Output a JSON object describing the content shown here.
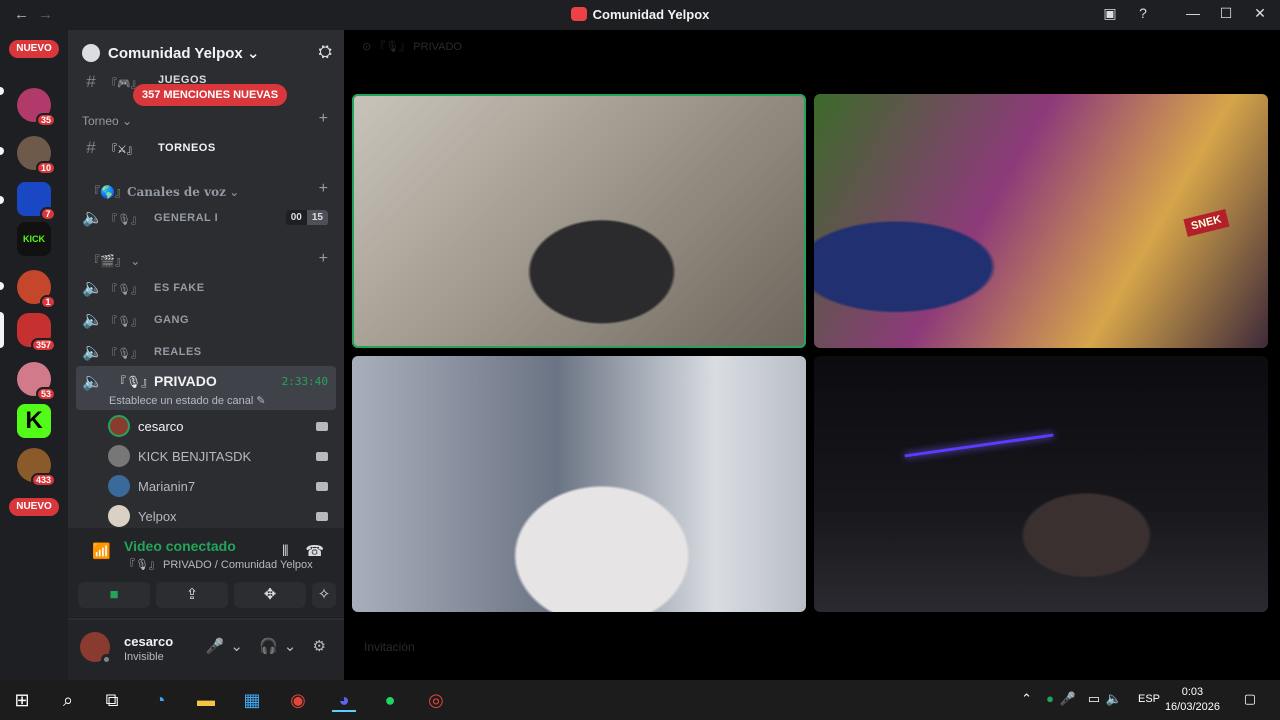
{
  "window": {
    "title": "Comunidad Yelpox",
    "back_icon": "←",
    "forward_icon": "→"
  },
  "rail": {
    "new_top": "NUEVO",
    "new_bottom": "NUEVO",
    "servers": [
      {
        "badge": "35",
        "color": "#b23a6a"
      },
      {
        "badge": "10",
        "color": "#6e5a4a"
      },
      {
        "badge": "7",
        "color": "#1a48c4"
      },
      {
        "badge": "",
        "label": "KICK",
        "color": "#111111"
      },
      {
        "badge": "1",
        "color": "#c5472b"
      },
      {
        "badge": "357",
        "color": "#c73030"
      },
      {
        "badge": "53",
        "color": "#d07a8a"
      },
      {
        "badge": "",
        "label": "K",
        "color": "#53fc18"
      },
      {
        "badge": "433",
        "color": "#8a5a2a"
      }
    ]
  },
  "sidebar": {
    "guild_name": "Comunidad Yelpox",
    "mention_pill": "357 MENCIONES NUEVAS",
    "channel_juegos": "JUEGOS",
    "category_torneo": "Torneo",
    "channel_torneos": "TORNEOS",
    "category_voz": "Canales de voz",
    "channel_general": "GENERAL I",
    "general_count_a": "00",
    "general_count_b": "15",
    "channel_fake": "ES FAKE",
    "channel_gang": "GANG",
    "channel_reales": "REALES",
    "channel_privado": "PRIVADO",
    "privado_timer": "2:33:40",
    "privado_status": "Establece un estado de canal",
    "members": [
      {
        "name": "cesarco",
        "color": "#8a3b2f"
      },
      {
        "name": "KICK BENJITASDK",
        "color": "#777777"
      },
      {
        "name": "Marianin7",
        "color": "#3a6a9a"
      },
      {
        "name": "Yelpox",
        "color": "#cfa"
      }
    ]
  },
  "voice": {
    "title": "Video conectado",
    "subtitle": "PRIVADO / Comunidad Yelpox"
  },
  "user": {
    "name": "cesarco",
    "status": "Invisible"
  },
  "stage": {
    "header": "PRIVADO",
    "footer": "Invitación",
    "sign": "SNEK"
  },
  "taskbar": {
    "lang": "ESP",
    "time": "0:03",
    "date": "16/03/2026"
  },
  "colors": {
    "accent_green": "#23a559",
    "badge_red": "#da373c",
    "sidebar": "#2b2d31",
    "rail": "#1e1f22"
  }
}
